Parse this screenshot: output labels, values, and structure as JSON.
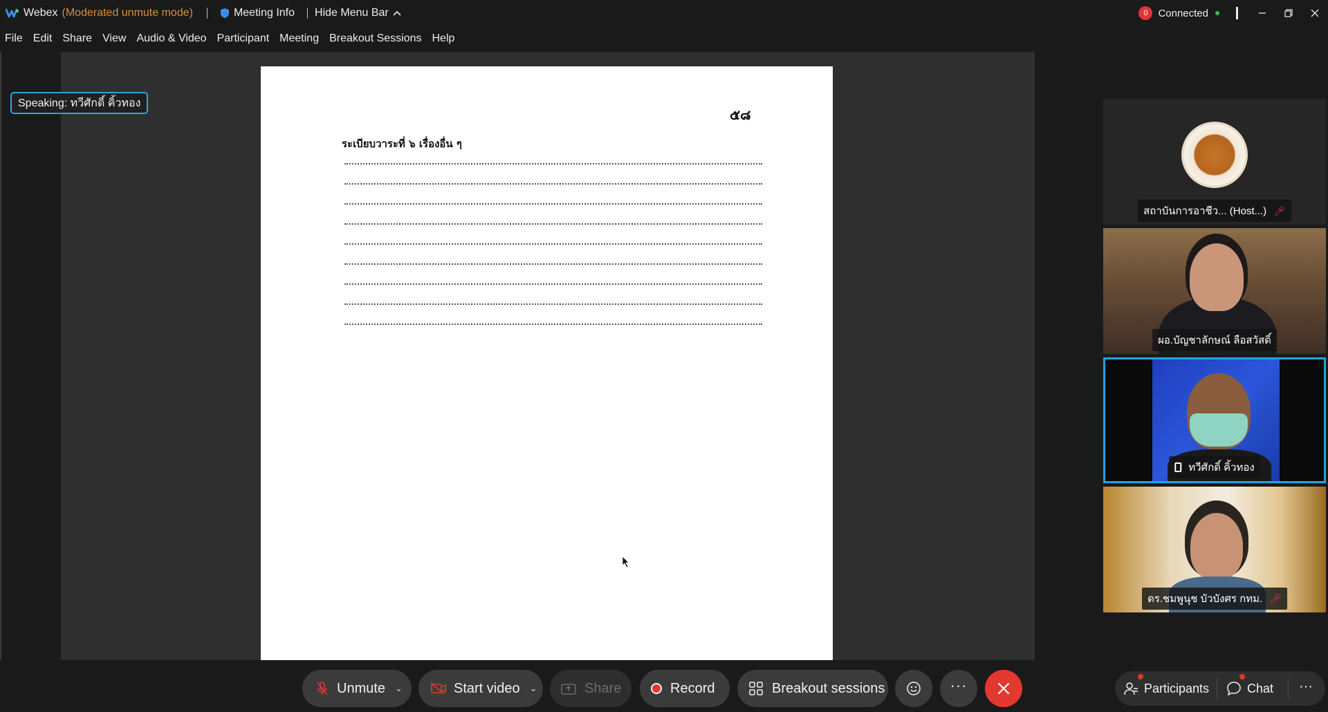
{
  "titlebar": {
    "app_name": "Webex",
    "app_mode": "(Moderated unmute mode)",
    "meeting_info": "Meeting Info",
    "hide_menu_bar": "Hide Menu Bar",
    "status_count": "0",
    "status": "Connected"
  },
  "menu": [
    "File",
    "Edit",
    "Share",
    "View",
    "Audio & Video",
    "Participant",
    "Meeting",
    "Breakout Sessions",
    "Help"
  ],
  "speaking": "Speaking: ทวีศักดิ์ คิ้วทอง",
  "document": {
    "page_number": "๕๘",
    "heading": "ระเบียบวาระที่ ๖  เรื่องอื่น ๆ",
    "dotted_line_count": 9
  },
  "participants": [
    {
      "name": "สถาบันการอาชีว... (Host...)",
      "muted": true
    },
    {
      "name": "ผอ.บัญชาลักษณ์ ลือสวัสดิ์",
      "muted": false
    },
    {
      "name": "ทวีศักดิ์ คิ้วทอง",
      "muted": false,
      "active": true
    },
    {
      "name": "ดร.ชมพูนุช บัวบังศร กทม.",
      "muted": true
    }
  ],
  "controls": {
    "unmute": "Unmute",
    "start_video": "Start video",
    "share": "Share",
    "record": "Record",
    "breakout": "Breakout sessions",
    "participants": "Participants",
    "chat": "Chat"
  },
  "colors": {
    "accent": "#1ea6e0",
    "danger": "#e2382f",
    "mode": "#d98e3a"
  }
}
